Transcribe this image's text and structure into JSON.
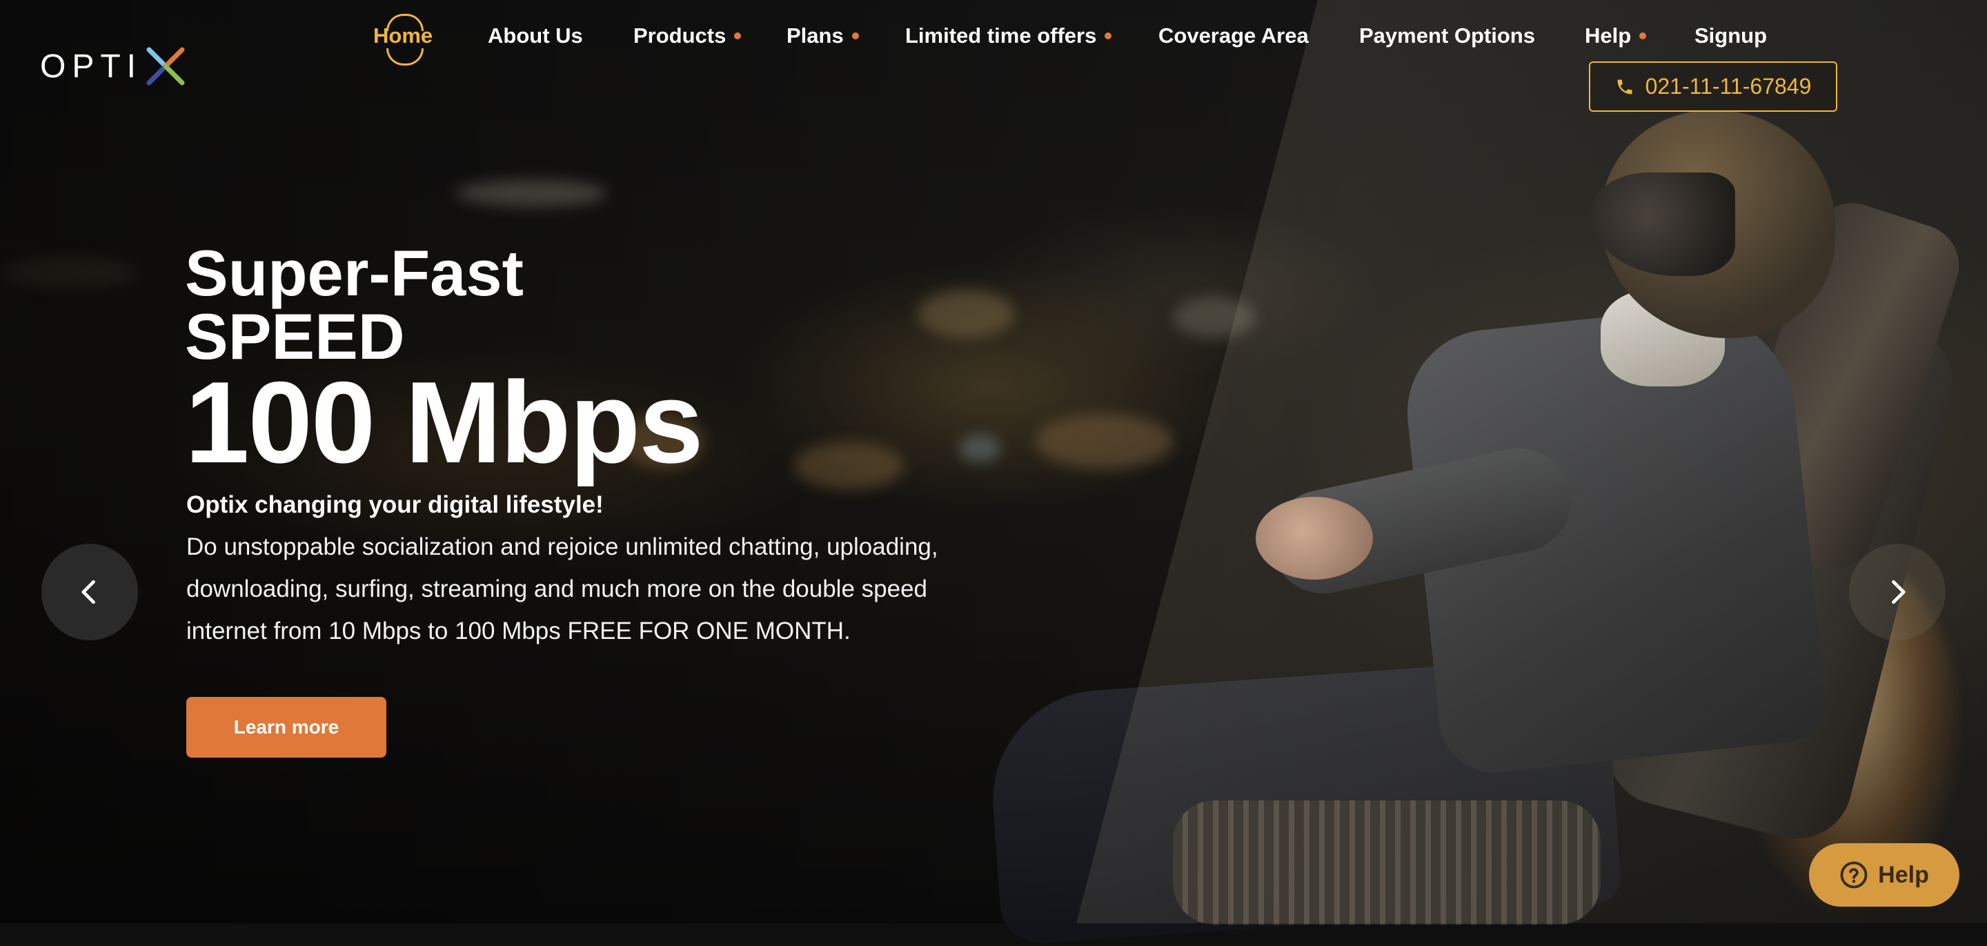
{
  "brand": {
    "logo_text": "OPTI"
  },
  "nav": {
    "items": [
      {
        "label": "Home",
        "active": true,
        "has_dropdown": false
      },
      {
        "label": "About Us",
        "active": false,
        "has_dropdown": false
      },
      {
        "label": "Products",
        "active": false,
        "has_dropdown": true
      },
      {
        "label": "Plans",
        "active": false,
        "has_dropdown": true
      },
      {
        "label": "Limited time offers",
        "active": false,
        "has_dropdown": true
      },
      {
        "label": "Coverage Area",
        "active": false,
        "has_dropdown": false
      },
      {
        "label": "Payment Options",
        "active": false,
        "has_dropdown": false
      },
      {
        "label": "Help",
        "active": false,
        "has_dropdown": true
      },
      {
        "label": "Signup",
        "active": false,
        "has_dropdown": false
      }
    ],
    "phone": "021-11-11-67849"
  },
  "hero": {
    "title_line1": "Super-Fast",
    "title_line2": "SPEED",
    "speed": "100 Mbps",
    "tagline": "Optix changing your digital lifestyle!",
    "description": "Do unstoppable socialization and rejoice unlimited chatting, uploading, downloading, surfing, streaming and much more on the double speed internet from 10 Mbps to 100 Mbps FREE FOR ONE MONTH.",
    "cta_label": "Learn more"
  },
  "carousel": {
    "prev_icon": "chevron-left-icon",
    "next_icon": "chevron-right-icon"
  },
  "help_widget": {
    "label": "Help",
    "icon": "question-circle-icon"
  },
  "colors": {
    "accent_gold": "#f0b73b",
    "accent_orange": "#e0783a",
    "help_widget_bg": "#d69a3f"
  }
}
